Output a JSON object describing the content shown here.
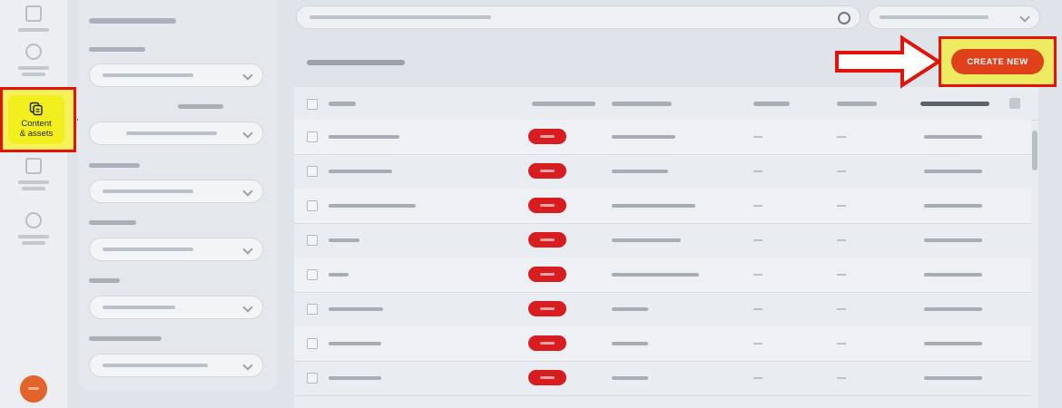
{
  "nav": {
    "active_item": {
      "label": "Content\n& assets",
      "icon": "copy-icon"
    },
    "items": [
      "home-icon",
      "globe-icon",
      "calendar-icon",
      "settings-icon"
    ]
  },
  "toolbar": {
    "create_label": "CREATE NEW"
  },
  "colors": {
    "highlight": "#f3ef1e",
    "annotation_red": "#e3120b",
    "primary": "#e0401a",
    "status_red": "#d71d20"
  },
  "filters": {
    "select_count": 6
  },
  "table": {
    "row_count": 8
  }
}
